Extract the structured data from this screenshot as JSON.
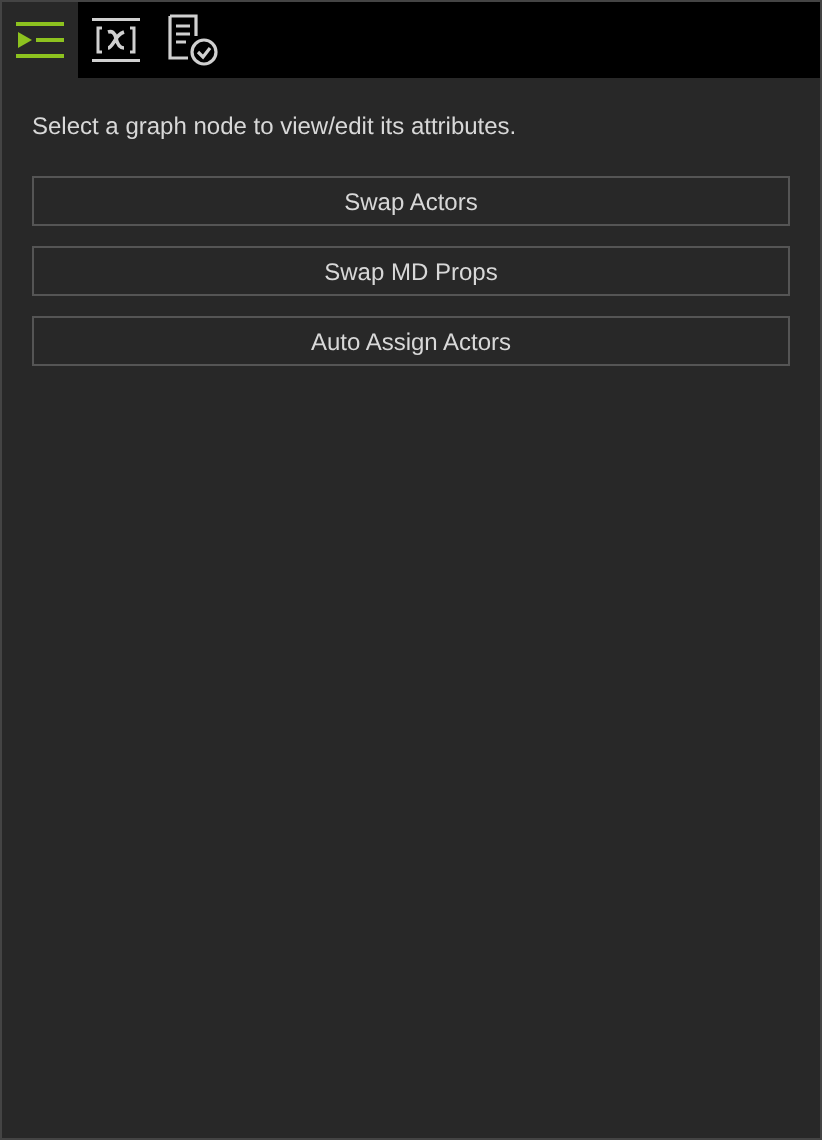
{
  "tabs": [
    {
      "kind": "outline",
      "selected": true
    },
    {
      "kind": "variable",
      "selected": false
    },
    {
      "kind": "checklist",
      "selected": false
    }
  ],
  "hint": "Select a graph node to view/edit its attributes.",
  "buttons": [
    "Swap Actors",
    "Swap MD Props",
    "Auto Assign Actors"
  ]
}
